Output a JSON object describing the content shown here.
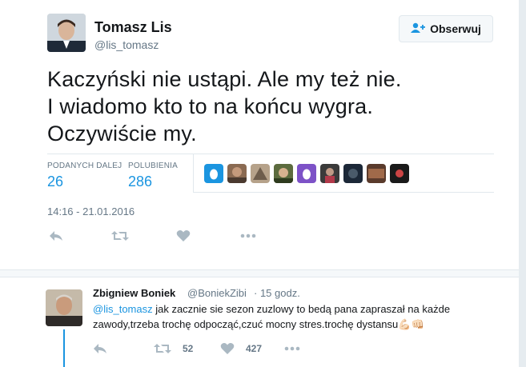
{
  "tweet": {
    "author_name": "Tomasz Lis",
    "author_handle": "@lis_tomasz",
    "follow_label": "Obserwuj",
    "text": "Kaczyński nie ustąpi. Ale my też nie.\nI wiadomo kto to na końcu wygra.\nOczywiście my.",
    "stats": [
      {
        "label": "PODANYCH DALEJ",
        "value": "26"
      },
      {
        "label": "POLUBIENIA",
        "value": "286"
      }
    ],
    "likers": [
      "egg-avatar",
      "liker-avatar",
      "liker-avatar",
      "liker-avatar",
      "egg-avatar",
      "liker-avatar",
      "liker-avatar",
      "liker-avatar",
      "liker-avatar"
    ],
    "timestamp": "14:16 - 21.01.2016",
    "actions": [
      "reply-icon",
      "retweet-icon",
      "heart-icon",
      "more-icon"
    ]
  },
  "reply": {
    "author_name": "Zbigniew Boniek",
    "author_handle": "@BoniekZibi",
    "time": "· 15 godz.",
    "mention": "@lis_tomasz",
    "text": " jak zacznie sie sezon zuzlowy to bedą pana zapraszał na każde zawody,trzeba trochę odpocząć,czuć mocny stres.trochę dystansu",
    "emoji": "💪🏻👊🏻",
    "retweet_count": "52",
    "like_count": "427"
  },
  "colors": {
    "accent": "#1b95e0",
    "muted": "#657786",
    "icon": "#aab8c2",
    "egg": "#1b95e0",
    "egg2": "#7d52c7"
  }
}
